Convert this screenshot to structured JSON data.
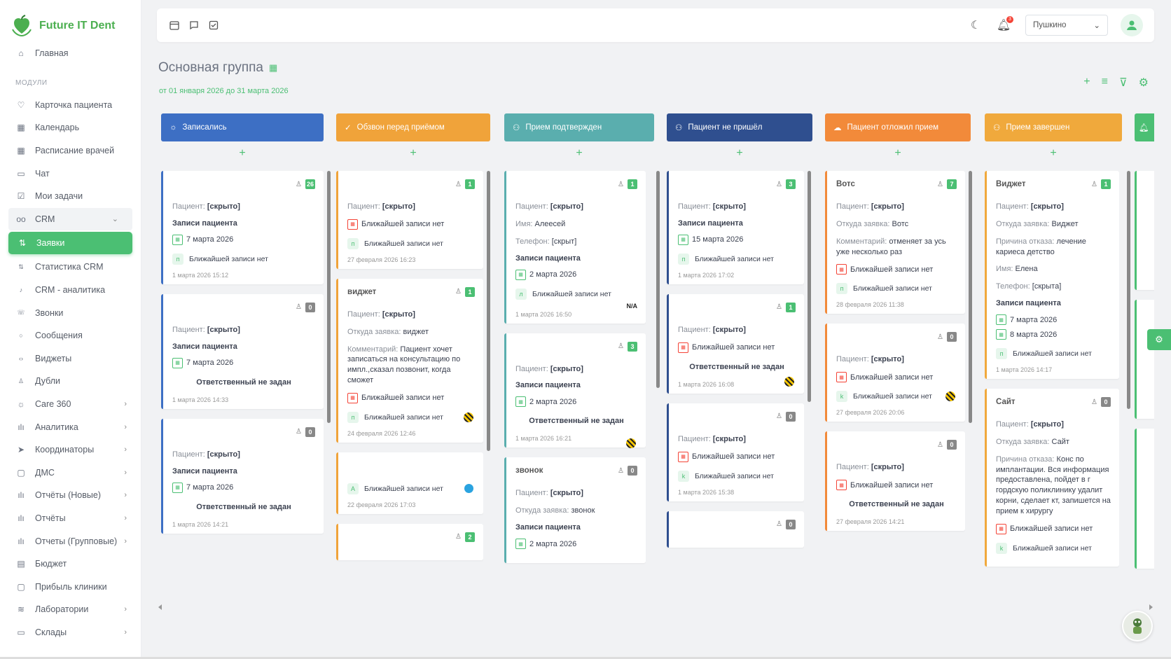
{
  "app": {
    "name": "Future IT Dent"
  },
  "sidebar": {
    "home": "Главная",
    "section_label": "МОДУЛИ",
    "items": [
      {
        "label": "Карточка пациента",
        "icon": "heart-icon"
      },
      {
        "label": "Календарь",
        "icon": "calendar-icon"
      },
      {
        "label": "Расписание врачей",
        "icon": "calendar-icon"
      },
      {
        "label": "Чат",
        "icon": "chat-icon"
      },
      {
        "label": "Мои задачи",
        "icon": "task-icon"
      }
    ],
    "crm": {
      "label": "CRM",
      "children": [
        "Заявки",
        "Статистика CRM",
        "CRM - аналитика",
        "Звонки",
        "Сообщения",
        "Виджеты",
        "Дубли"
      ]
    },
    "items2": [
      {
        "label": "Care 360",
        "icon": "sun-icon"
      },
      {
        "label": "Аналитика",
        "icon": "bar-chart-icon"
      },
      {
        "label": "Координаторы",
        "icon": "send-icon"
      },
      {
        "label": "ДМС",
        "icon": "clipboard-icon"
      },
      {
        "label": "Отчёты (Новые)",
        "icon": "bar-chart-icon"
      },
      {
        "label": "Отчёты",
        "icon": "bar-chart-icon"
      },
      {
        "label": "Отчеты (Групповые)",
        "icon": "bar-chart-icon"
      },
      {
        "label": "Бюджет",
        "icon": "wallet-icon"
      },
      {
        "label": "Прибыль клиники",
        "icon": "clipboard-icon"
      },
      {
        "label": "Лаборатории",
        "icon": "layers-icon"
      },
      {
        "label": "Склады",
        "icon": "folder-icon"
      }
    ]
  },
  "topbar": {
    "branch": "Пушкино",
    "notifications": "3"
  },
  "page": {
    "title": "Основная группа",
    "range": "от 01 января 2026 до 31 марта 2026"
  },
  "columns": [
    {
      "title": "Записались",
      "color": "#3d6fc4",
      "icon": "sun"
    },
    {
      "title": "Обзвон перед приёмом",
      "color": "#f0a33a",
      "icon": "check"
    },
    {
      "title": "Прием подтвержден",
      "color": "#5aaeae",
      "icon": "user-plus"
    },
    {
      "title": "Пациент не пришёл",
      "color": "#2f4f8f",
      "icon": "user-minus"
    },
    {
      "title": "Пациент отложил прием",
      "color": "#f28a3a",
      "icon": "cloud"
    },
    {
      "title": "Прием завершен",
      "color": "#f0a93c",
      "icon": "user-check"
    }
  ],
  "labels": {
    "patient": "Пациент:",
    "hidden": "[скрыто]",
    "records": "Записи пациента",
    "no_next": "Ближайшей записи нет",
    "no_resp": "Ответственный не задан",
    "source": "Откуда заявка:",
    "comment": "Комментарий:",
    "reason": "Причина отказа:",
    "name": "Имя:",
    "phone": "Телефон:"
  },
  "cards": {
    "c1a": {
      "count": "26",
      "date": "7 марта 2026",
      "letter": "п",
      "stamp": "1 марта 2026 15:12"
    },
    "c1b": {
      "count": "0",
      "date": "7 марта 2026",
      "stamp": "1 марта 2026 14:33"
    },
    "c1c": {
      "count": "0",
      "date": "7 марта 2026",
      "stamp": "1 марта 2026 14:21"
    },
    "c2a": {
      "count": "1",
      "letter": "п",
      "stamp": "27 февраля 2026 16:23"
    },
    "c2b": {
      "title": "виджет",
      "count": "1",
      "source": "виджет",
      "comment": "Пациент хочет записаться на консультацию по импл.,сказал позвонит, когда сможет",
      "letter": "п",
      "stamp": "24 февраля 2026 12:46"
    },
    "c2c": {
      "letter": "А",
      "stamp": "22 февраля 2026 17:03"
    },
    "c2d": {
      "count": "2"
    },
    "c3a": {
      "count": "1",
      "name": "Алеесей",
      "phone": "[скрыт]",
      "date": "2 марта 2026",
      "letter": "л",
      "na": "N/A",
      "stamp": "1 марта 2026 16:50"
    },
    "c3b": {
      "count": "3",
      "date": "2 марта 2026",
      "stamp": "1 марта 2026 16:21"
    },
    "c3c": {
      "title": "звонок",
      "count": "0",
      "source": "звонок",
      "date": "2 марта 2026"
    },
    "c4a": {
      "count": "3",
      "date": "15 марта 2026",
      "letter": "п",
      "stamp": "1 марта 2026 17:02"
    },
    "c4b": {
      "count": "1",
      "stamp": "1 марта 2026 16:08"
    },
    "c4c": {
      "count": "0",
      "letter": "k",
      "stamp": "1 марта 2026 15:38"
    },
    "c4d": {
      "count": "0"
    },
    "c5a": {
      "title": "Вотс",
      "count": "7",
      "source": "Вотс",
      "comment": "отменяет за усь уже несколько раз",
      "letter": "п",
      "stamp": "28 февраля 2026 11:38"
    },
    "c5b": {
      "count": "0",
      "letter": "k",
      "stamp": "27 февраля 2026 20:06"
    },
    "c5c": {
      "count": "0",
      "stamp": "27 февраля 2026 14:21"
    },
    "c6a": {
      "title": "Виджет",
      "count": "1",
      "source": "Виджет",
      "reason": "лечение кариеса детство",
      "name": "Елена",
      "phone": "[скрыта]",
      "date1": "7 марта 2026",
      "date2": "8 марта 2026",
      "letter": "п",
      "stamp": "1 марта 2026 14:17"
    },
    "c6b": {
      "title": "Сайт",
      "count": "0",
      "source": "Сайт",
      "reason": "Конс по имплантации. Вся информация предоставлена, пойдет в г гордскую поликлинику удалит корни, сделает кт, запишется на прием к хирургу",
      "letter": "k"
    }
  }
}
